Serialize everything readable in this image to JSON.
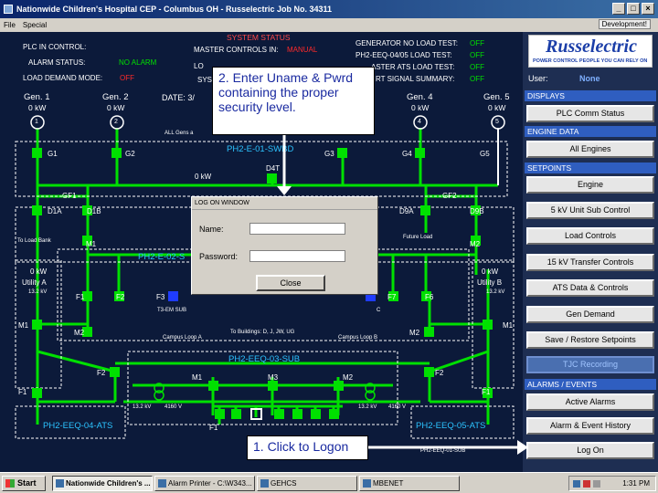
{
  "window": {
    "title": "Nationwide Children's Hospital CEP - Columbus OH - Russelectric Job No. 34311",
    "buttons": {
      "minimize": "_",
      "maximize": "□",
      "close": "×"
    }
  },
  "menu": {
    "items": [
      "File",
      "Special"
    ],
    "development": "Development!"
  },
  "status": {
    "system_status": "SYSTEM STATUS",
    "plc_in_control_label": "PLC IN CONTROL:",
    "master_controls_label": "MASTER CONTROLS IN:",
    "master_controls_value": "MANUAL",
    "alarm_status_label": "ALARM STATUS:",
    "alarm_status_value": "NO ALARM",
    "load_demand_label": "LOAD DEMAND MODE:",
    "load_demand_value": "OFF",
    "partial_lo": "LO",
    "partial_system": "SYSTEM",
    "gen_no_load_label": "GENERATOR NO LOAD TEST:",
    "gen_no_load_value": "OFF",
    "ph2_load_label": "PH2-EEQ-04/05 LOAD TEST:",
    "ph2_load_value": "OFF",
    "master_ats_label": "ASTER ATS LOAD TEST:",
    "master_ats_value": "OFF",
    "start_signal_label": "RT SIGNAL SUMMARY:",
    "start_signal_value": "OFF"
  },
  "brand": {
    "name": "Russelectric",
    "tagline": "POWER CONTROL PEOPLE YOU CAN RELY ON"
  },
  "user": {
    "label": "User:",
    "value": "None"
  },
  "panel": {
    "displays": "DISPLAYS",
    "plc_comm": "PLC Comm Status",
    "engine_data": "ENGINE DATA",
    "all_engines": "All Engines",
    "setpoints": "SETPOINTS",
    "engine": "Engine",
    "unit_sub": "5 kV Unit Sub Control",
    "load_controls": "Load Controls",
    "transfer_controls": "15 kV Transfer Controls",
    "ats_data": "ATS Data & Controls",
    "gen_demand": "Gen Demand",
    "save_restore": "Save / Restore Setpoints",
    "tjc": "TJC Recording",
    "alarms_events": "ALARMS / EVENTS",
    "active_alarms": "Active Alarms",
    "alarm_history": "Alarm & Event History",
    "log_on": "Log On"
  },
  "generators": [
    {
      "name": "Gen. 1",
      "kw": "0 kW",
      "num": "1"
    },
    {
      "name": "Gen. 2",
      "kw": "0 kW",
      "num": "2"
    },
    {
      "name": "Gen. 4",
      "kw": "0 kW",
      "num": "4"
    },
    {
      "name": "Gen. 5",
      "kw": "0 kW",
      "num": "5"
    }
  ],
  "diagram": {
    "date_label": "DATE: 3/",
    "all_gens": "ALL Gens a",
    "swbd": "PH2-E-01-SWBD",
    "g1": "G1",
    "g2": "G2",
    "g3": "G3",
    "g4": "G4",
    "g5": "G5",
    "bus_kw": "0 kW",
    "d4t": "D4T",
    "gf1": "GF1",
    "gf2": "GF2",
    "d1a": "D1A",
    "d1b": "D1B",
    "d9a": "D9A",
    "d9b": "D9B",
    "to_load_bank": "To Load Bank",
    "future": "ture",
    "future_load": "Future Load",
    "m1_left": "M1",
    "m2_right": "M2",
    "eq02": "PH2-E-02-S",
    "util_a_kw": "0 kW",
    "util_a": "Utility A",
    "util_a_v": "13.2 kV",
    "util_b_kw": "0 kW",
    "util_b": "Utility B",
    "util_b_v": "13.2 kV",
    "f1": "F1",
    "f2": "F2",
    "f3": "F3",
    "f7": "F7",
    "f6": "F6",
    "t3em": "T3-EM SUB",
    "c": "C",
    "m1": "M1",
    "m2": "M2",
    "to_buildings": "To Buildings: D, J, JW, UG",
    "campus_a": "Campus Loop A",
    "campus_b": "Campus Loop B",
    "eq03": "PH2-EEQ-03-SUB",
    "f2b": "F2",
    "m1b": "M1",
    "m3": "M3",
    "m2b": "M2",
    "f2c": "F2",
    "f1l": "F1",
    "f1r": "F1",
    "kv132a": "13.2 kV",
    "v4160a": "4160 V",
    "kv132b": "13.2 kV",
    "v4160b": "4160 V",
    "f1b": "F1",
    "eq04": "PH2-EEQ-04-ATS",
    "eq05": "PH2-EEQ-05-ATS",
    "eq01": "PH2-EEQ-01-SUB"
  },
  "callouts": {
    "step2": "2. Enter Uname & Pwrd containing the proper security level.",
    "step1": "1. Click to Logon"
  },
  "logon": {
    "title": "LOG ON WINDOW",
    "name_label": "Name:",
    "password_label": "Password:",
    "name_value": "",
    "password_value": "",
    "close": "Close"
  },
  "taskbar": {
    "start": "Start",
    "items": [
      "Nationwide Children's ...",
      "Alarm Printer - C:\\W343...",
      "GEHCS",
      "MBENET"
    ],
    "clock": "1:31 PM"
  },
  "colors": {
    "bus": "#00e000",
    "label_blue": "#2cc3ff",
    "panel_blue": "#2f5ec0",
    "alarm_red": "#ff2a2a"
  }
}
